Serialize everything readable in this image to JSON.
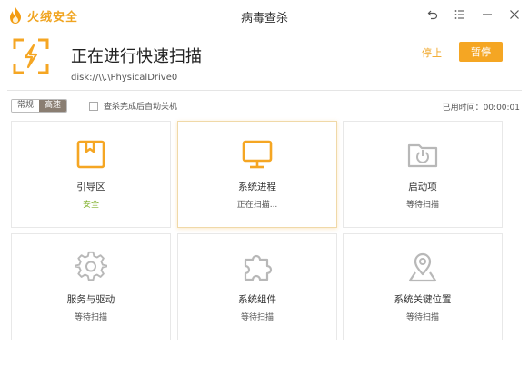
{
  "window": {
    "brand": "火绒安全",
    "title": "病毒查杀"
  },
  "scan": {
    "title": "正在进行快速扫描",
    "path": "disk://\\\\.\\PhysicalDrive0",
    "stop_label": "停止",
    "pause_label": "暂停"
  },
  "options": {
    "mode_normal": "常规",
    "mode_fast": "高速",
    "mode_selected": "高速",
    "auto_shutdown_label": "查杀完成后自动关机",
    "auto_shutdown_checked": false,
    "elapsed_label": "已用时间：00:00:01"
  },
  "cards": [
    {
      "name": "引导区",
      "status": "安全",
      "icon": "boot-sector-icon",
      "state": "safe"
    },
    {
      "name": "系统进程",
      "status": "正在扫描...",
      "icon": "monitor-icon",
      "state": "scanning"
    },
    {
      "name": "启动项",
      "status": "等待扫描",
      "icon": "startup-folder-icon",
      "state": "waiting"
    },
    {
      "name": "服务与驱动",
      "status": "等待扫描",
      "icon": "gear-icon",
      "state": "waiting"
    },
    {
      "name": "系统组件",
      "status": "等待扫描",
      "icon": "puzzle-icon",
      "state": "waiting"
    },
    {
      "name": "系统关键位置",
      "status": "等待扫描",
      "icon": "map-pin-icon",
      "state": "waiting"
    }
  ],
  "colors": {
    "accent": "#f5a623",
    "safe": "#7fb02a",
    "inactive_icon": "#b8b8b8"
  }
}
